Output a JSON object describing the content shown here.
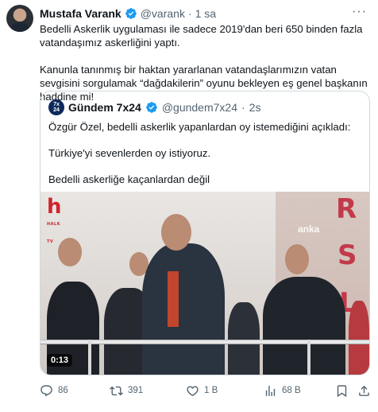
{
  "author": {
    "name": "Mustafa Varank",
    "handle": "@varank",
    "separator": "·",
    "time": "1 sa",
    "avatar_icon": "avatar-photo"
  },
  "tweet": {
    "line1": "Bedelli Askerlik uygulaması ile sadece 2019'dan beri 650 binden fazla vatandaşımız askerliğini yaptı.",
    "line2": "Kanunla tanınmış bir haktan yararlanan vatandaşlarımızın vatan sevgisini sorgulamak “dağdakilerin” oyunu bekleyen eş genel başkanın haddine mi!"
  },
  "quote": {
    "name": "Gündem 7x24",
    "handle": "@gundem7x24",
    "separator": "·",
    "time": "2s",
    "avatar_text": "Gündem 7x24",
    "line1": "Özgür Özel, bedelli askerlik yapanlardan oy istemediğini açıkladı:",
    "line2": "Türkiye'yi sevenlerden oy istiyoruz.",
    "line3": "Bedelli askerliğe kaçanlardan değil",
    "video": {
      "duration": "0:13",
      "channel_logo": "h",
      "channel_logo_sub": "HALK TV",
      "watermark": "anka",
      "sign_letters": [
        "R",
        "S",
        "L"
      ]
    }
  },
  "actions": {
    "replies": "86",
    "retweets": "391",
    "likes": "1 B",
    "views": "68 B"
  },
  "colors": {
    "verified": "#1d9bf0",
    "muted": "#536471",
    "border": "#cfd9de"
  }
}
